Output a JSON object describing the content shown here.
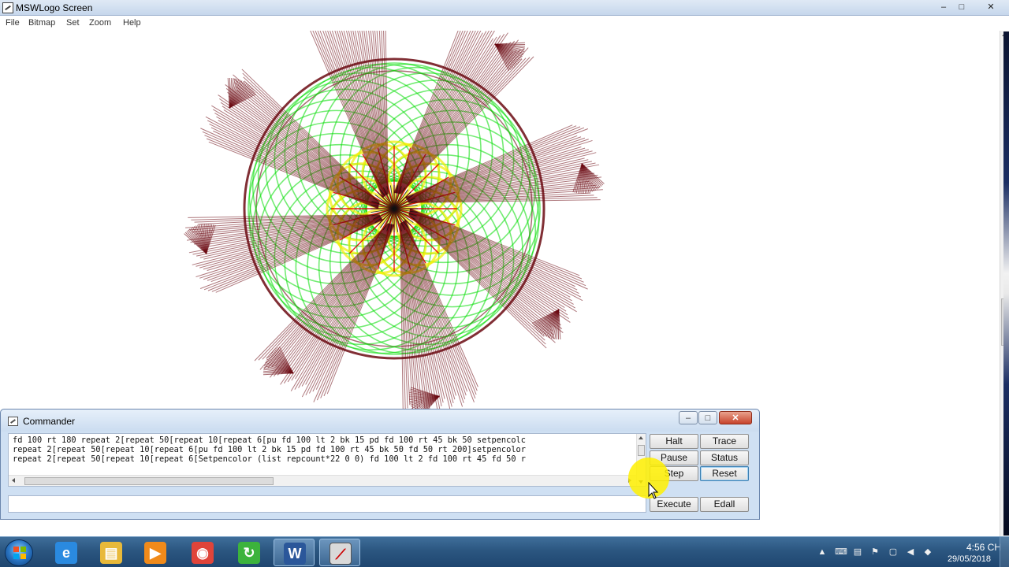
{
  "window": {
    "title": "MSWLogo Screen",
    "controls": {
      "minimize": "–",
      "maximize": "□",
      "close": "✕"
    }
  },
  "menubar": {
    "items": [
      "File",
      "Bitmap",
      "Set",
      "Zoom",
      "Help"
    ]
  },
  "drawing": {
    "description_colors": {
      "dark": "#6b0a12",
      "green": "#00dd00",
      "yellow": "#f2ee00",
      "red": "#e00000"
    },
    "arms": 8
  },
  "commander": {
    "title": "Commander",
    "controls": {
      "minimize": "–",
      "maximize": "□",
      "close": "✕"
    },
    "history": [
      "fd 100 rt 180 repeat 2[repeat 50[repeat 10[repeat 6[pu fd 100 lt 2 bk 15 pd fd 100 rt 45 bk 50 setpencolc",
      "repeat 2[repeat 50[repeat 10[repeat 6[pu fd 100 lt 2 bk 15 pd fd 100 rt 45 bk 50 fd 50 rt 200]setpencolor",
      "repeat 2[repeat 50[repeat 10[repeat 6[Setpencolor (list repcount*22 0 0) fd 100 lt 2 fd 100 rt 45 fd 50 r"
    ],
    "input_value": "",
    "buttons": {
      "halt": "Halt",
      "trace": "Trace",
      "pause": "Pause",
      "status": "Status",
      "step": "Step",
      "reset": "Reset",
      "execute": "Execute",
      "edall": "Edall"
    }
  },
  "taskbar": {
    "apps": [
      {
        "name": "internet-explorer",
        "glyph": "e",
        "color": "#2a8ae0"
      },
      {
        "name": "file-explorer",
        "glyph": "▤",
        "color": "#e8b93a"
      },
      {
        "name": "media-player",
        "glyph": "▶",
        "color": "#f08a1a"
      },
      {
        "name": "chrome",
        "glyph": "◉",
        "color": "#e0443a"
      },
      {
        "name": "green-app",
        "glyph": "↻",
        "color": "#3cb33c"
      },
      {
        "name": "word",
        "glyph": "W",
        "color": "#2b579a"
      },
      {
        "name": "mswlogo",
        "glyph": "⟋",
        "color": "#d9d9d9"
      }
    ],
    "clock_time": "4:56 CH",
    "clock_date": "29/05/2018"
  }
}
